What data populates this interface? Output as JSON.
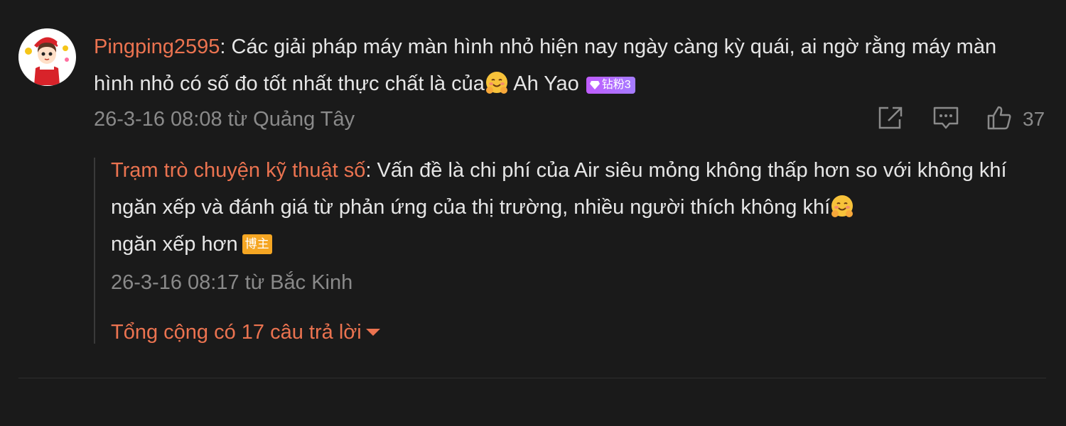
{
  "comment": {
    "username": "Pingping2595",
    "separator": ": ",
    "text": "Các giải pháp máy màn hình nhỏ hiện nay ngày càng kỳ quái, ai ngờ rằng máy màn hình nhỏ có số đo tốt nhất thực chất là của",
    "emoji_icon": "hugging-face-emoji-icon",
    "text_after": " Ah Yao",
    "fan_badge": "钻粉3",
    "time_location": "26-3-16 08:08 từ Quảng Tây",
    "like_count": "37"
  },
  "reply": {
    "username": "Trạm trò chuyện kỹ thuật số",
    "separator": ": ",
    "text": "Vấn đề là chi phí của Air siêu mỏng không thấp hơn so với không khí ngăn xếp và đánh giá từ phản ứng của thị trường, nhiều người thích không khí",
    "emoji_icon": "hugging-face-emoji-icon",
    "text_after": "ngăn xếp hơn",
    "host_badge": "博主",
    "time_location": "26-3-16 08:17 từ Bắc Kinh"
  },
  "reply_total": "Tổng cộng có 17 câu trả lời",
  "icons": {
    "share": "share-icon",
    "comment": "comment-icon",
    "like": "thumbs-up-icon",
    "expand": "caret-down-icon"
  },
  "colors": {
    "background": "#1a1a1a",
    "username": "#eb7350",
    "text": "#e6e6e6",
    "meta": "#8a8a8a",
    "fan_badge": "#b36bff",
    "host_badge": "#f5a623"
  }
}
